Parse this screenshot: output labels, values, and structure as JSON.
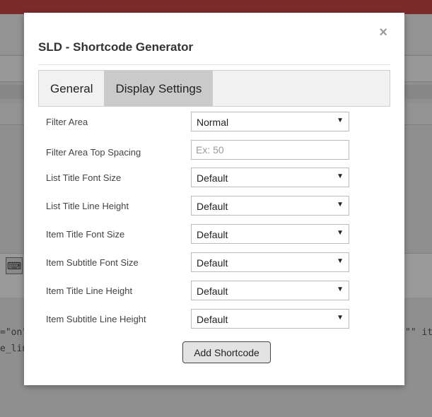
{
  "modal": {
    "title": "SLD - Shortcode Generator",
    "close_symbol": "×",
    "tabs": [
      {
        "label": "General"
      },
      {
        "label": "Display Settings"
      }
    ],
    "fields": [
      {
        "label": "Filter Area",
        "value": "Normal"
      },
      {
        "label": "Filter Area Top Spacing",
        "placeholder": "Ex: 50"
      },
      {
        "label": "List Title Font Size",
        "value": "Default"
      },
      {
        "label": "List Title Line Height",
        "value": "Default"
      },
      {
        "label": "Item Title Font Size",
        "value": "Default"
      },
      {
        "label": "Item Subtitle Font Size",
        "value": "Default"
      },
      {
        "label": "Item Title Line Height",
        "value": "Default"
      },
      {
        "label": "Item Subtitle Line Height",
        "value": "Default"
      }
    ],
    "submit_label": "Add Shortcode"
  },
  "background": {
    "text_line1": "=\"on\"",
    "text_line2": "e_line",
    "text_right": "\"\" iter",
    "keyboard_icon": "keyboard-icon"
  }
}
